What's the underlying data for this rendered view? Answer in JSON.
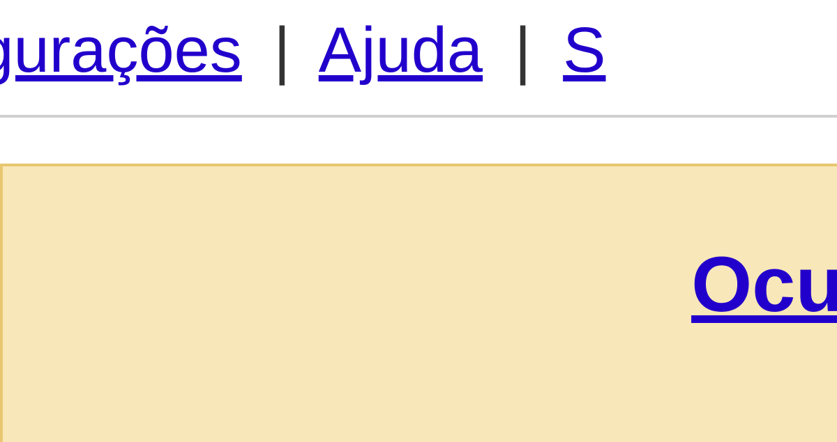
{
  "nav": {
    "link_configuracoes": "onfigurações",
    "separator": "|",
    "link_ajuda": "Ajuda",
    "link_sair": "S"
  },
  "panel": {
    "link_ocultar": "Ocul"
  },
  "colors": {
    "link": "#2200cc",
    "panel_bg": "#f8e7b8",
    "panel_border": "#e8c770",
    "separator_border": "#d0d0d0"
  }
}
